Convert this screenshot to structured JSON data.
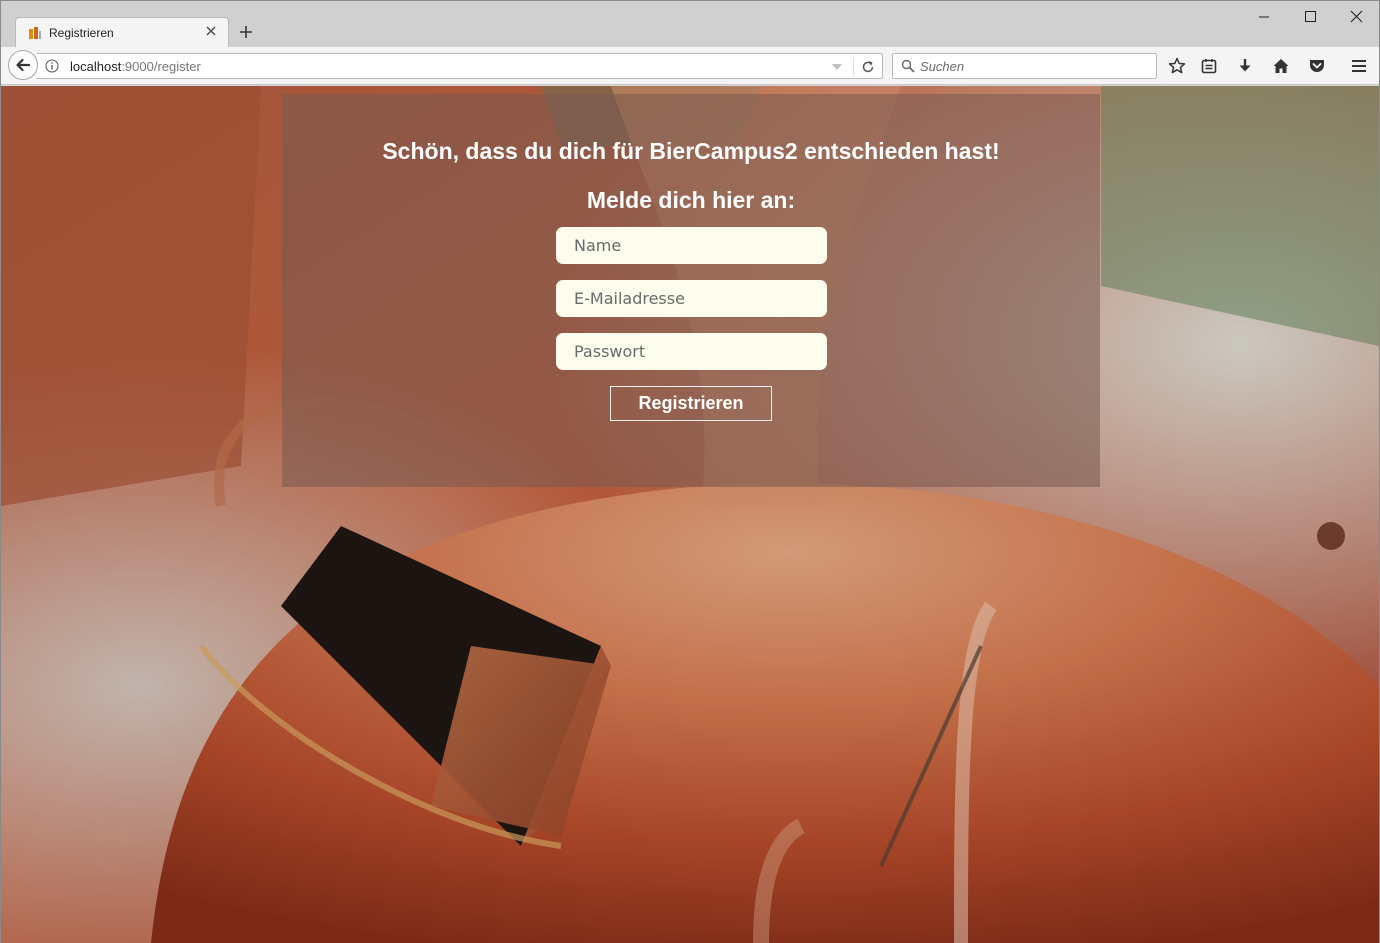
{
  "browser": {
    "tab": {
      "title": "Registrieren"
    },
    "address": {
      "host": "localhost",
      "rest": ":9000/register"
    },
    "search": {
      "placeholder": "Suchen"
    }
  },
  "page": {
    "headline": "Schön, dass du dich für BierCampus2 entschieden hast!",
    "subline": "Melde dich hier an:",
    "form": {
      "name_placeholder": "Name",
      "email_placeholder": "E-Mailadresse",
      "password_placeholder": "Passwort",
      "submit_label": "Registrieren"
    }
  },
  "icons": {
    "tab_favicon": "beer-favicon",
    "tab_close": "close-icon",
    "new_tab": "plus-icon",
    "back": "back-arrow-icon",
    "info": "info-icon",
    "reload": "reload-icon",
    "search": "search-icon",
    "toolbar": [
      "star-icon",
      "reading-list-icon",
      "download-icon",
      "home-icon",
      "pocket-icon",
      "menu-icon"
    ],
    "window": [
      "minimize-icon",
      "maximize-icon",
      "close-window-icon"
    ]
  },
  "colors": {
    "tabbar": "#d0d0d0",
    "input_bg": "#fdfdee",
    "card_overlay": "rgba(120, 90, 80, 0.55)"
  }
}
